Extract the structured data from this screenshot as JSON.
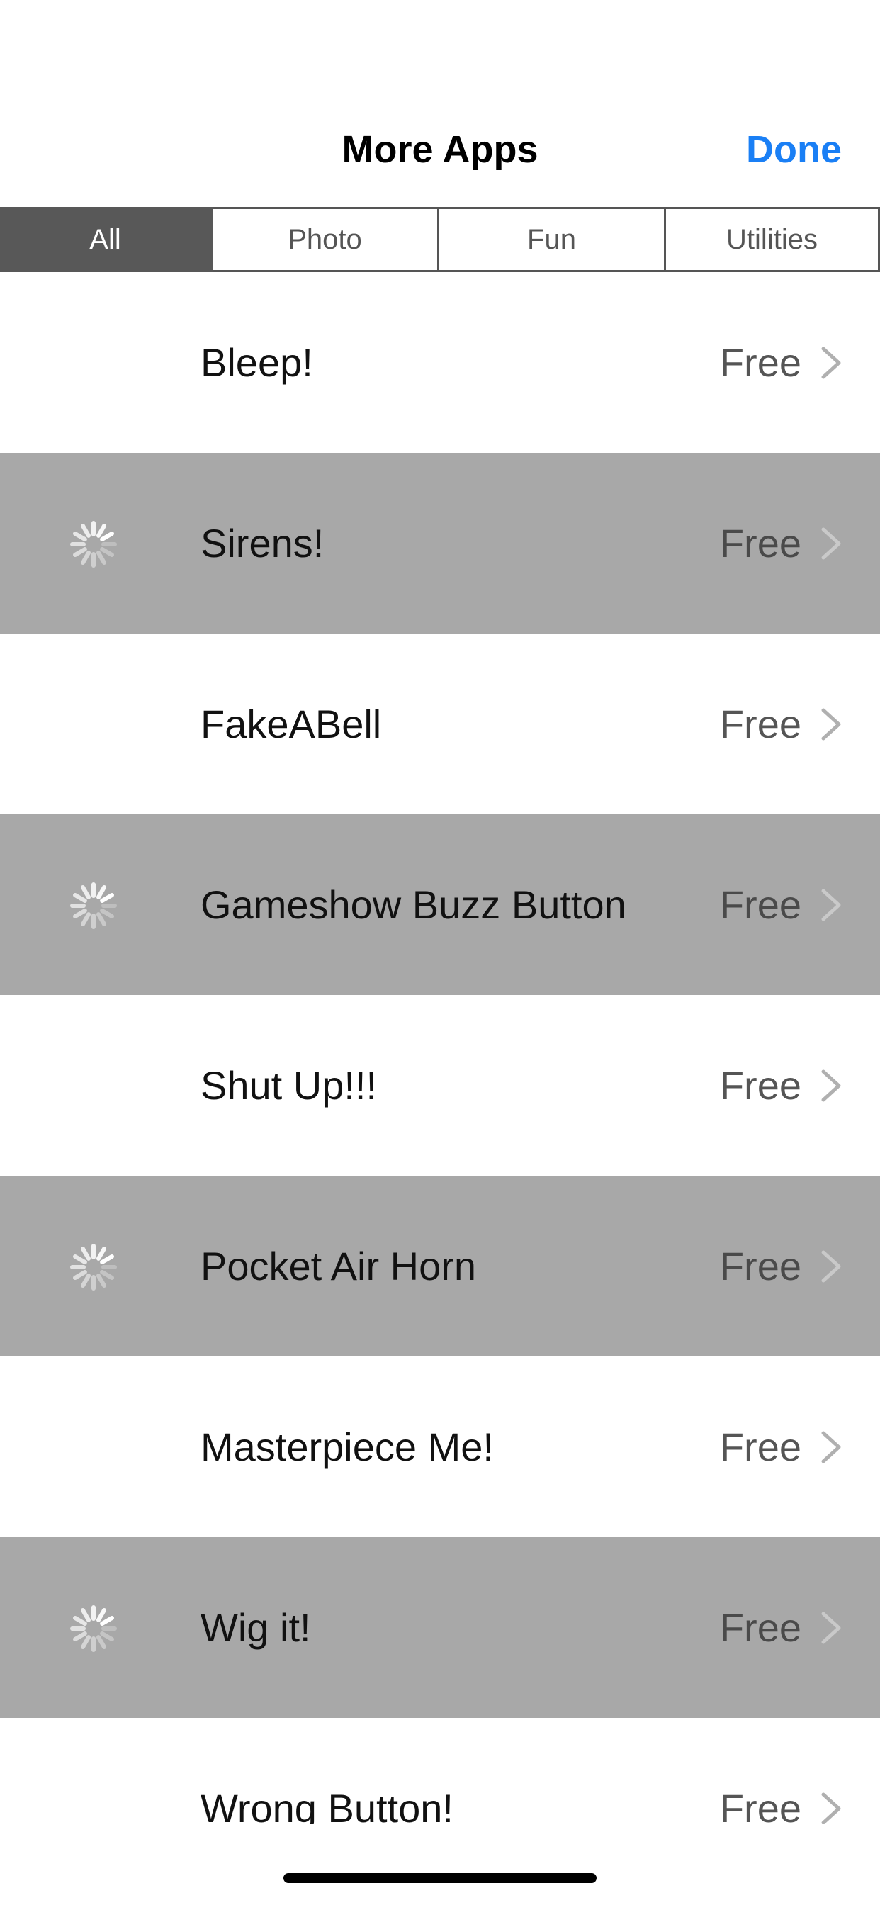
{
  "header": {
    "title": "More Apps",
    "done_label": "Done"
  },
  "tabs": [
    {
      "label": "All",
      "selected": true
    },
    {
      "label": "Photo",
      "selected": false
    },
    {
      "label": "Fun",
      "selected": false
    },
    {
      "label": "Utilities",
      "selected": false
    }
  ],
  "apps": [
    {
      "name": "Bleep!",
      "price": "Free",
      "loading": false
    },
    {
      "name": "Sirens!",
      "price": "Free",
      "loading": true
    },
    {
      "name": "FakeABell",
      "price": "Free",
      "loading": false
    },
    {
      "name": "Gameshow Buzz Button",
      "price": "Free",
      "loading": true
    },
    {
      "name": "Shut Up!!!",
      "price": "Free",
      "loading": false
    },
    {
      "name": "Pocket Air Horn",
      "price": "Free",
      "loading": true
    },
    {
      "name": "Masterpiece Me!",
      "price": "Free",
      "loading": false
    },
    {
      "name": "Wig it!",
      "price": "Free",
      "loading": true
    },
    {
      "name": "Wrong Button!",
      "price": "Free",
      "loading": false
    }
  ],
  "colors": {
    "accent": "#1a7ff5",
    "alt_row": "#a8a8a8",
    "selected_tab": "#585858"
  },
  "icons": {
    "row_chevron": "chevron-right-icon",
    "row_loading": "activity-spinner-icon"
  }
}
